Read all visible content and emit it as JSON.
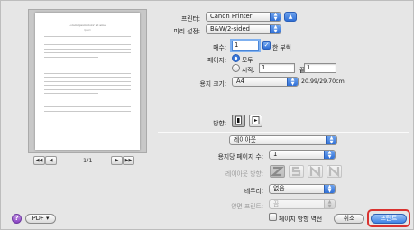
{
  "printer": {
    "label": "프린터:",
    "value": "Canon Printer",
    "disclosure_icon": "triangle-up-icon"
  },
  "presets": {
    "label": "미리 설정:",
    "value": "B&W/2-sided"
  },
  "copies": {
    "label": "매수:",
    "value": "1",
    "collated_label": "한 부씩",
    "collated": true
  },
  "pages": {
    "label": "페이지:",
    "all_label": "모두",
    "from_label": "시작:",
    "from_value": "1",
    "to_label": "끝:",
    "to_value": "1",
    "selected": "all"
  },
  "paper_size": {
    "label": "용지 크기:",
    "value": "A4",
    "dimensions": "20.99/29.70cm"
  },
  "orientation": {
    "label": "방향:",
    "selected": "portrait"
  },
  "panel": {
    "value": "레이아웃"
  },
  "layout": {
    "pages_per_sheet_label": "용지당 페이지 수:",
    "pages_per_sheet_value": "1",
    "direction_label": "레이아웃 방향:",
    "border_label": "테두리:",
    "border_value": "없음",
    "two_sided_label": "양면 프린트:",
    "two_sided_value": "끔",
    "reverse_label": "페이지 방향 역전",
    "reverse_checked": false
  },
  "preview": {
    "title": "Lorem ipsum dolor sit amet",
    "subtitle": "Ipsum",
    "pager_first": "◀◀",
    "pager_prev": "◀",
    "pager_next": "▶",
    "pager_last": "▶▶",
    "page_indicator": "1/1"
  },
  "footer": {
    "help_label": "?",
    "pdf_label": "PDF ▾",
    "cancel_label": "취소",
    "print_label": "프린트"
  },
  "colors": {
    "accent": "#3f82e4",
    "highlight": "#d9322f"
  }
}
